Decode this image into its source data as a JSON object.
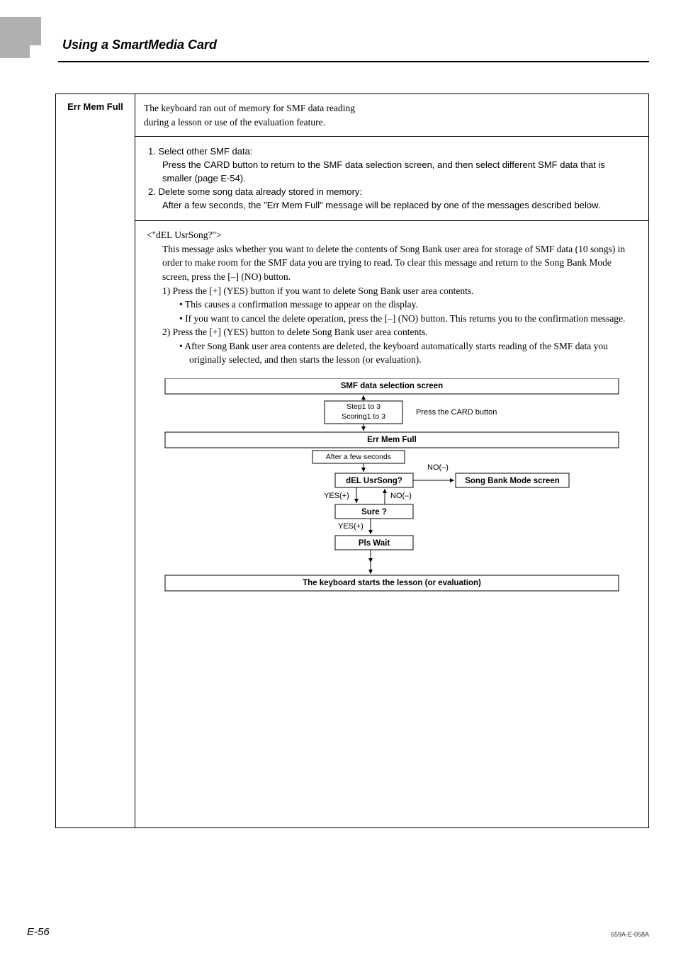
{
  "header": {
    "title": "Using a SmartMedia Card"
  },
  "error": {
    "name": "Err  Mem  Full",
    "desc_line1": "The keyboard ran out of memory for SMF data reading",
    "desc_line2": "during a lesson or use of the evaluation feature."
  },
  "solution": {
    "item1_lead": "1.  Select other SMF data:",
    "item1_body": "Press the CARD button to return to the SMF data selection screen, and then select different SMF data that is smaller (page E-54).",
    "item2_lead": "2.  Delete some song data already stored in memory:",
    "item2_body": "After a few seconds, the \"Err Mem Full\" message will be replaced by one of the messages described below."
  },
  "del": {
    "lead": "<\"dEL UsrSong?\">",
    "para": "This message asks whether you want to delete the contents of Song Bank user area for storage of SMF data (10 songs) in order to make room for the SMF data you are trying to read. To clear this message and return to the Song Bank Mode screen, press the [–] (NO) button.",
    "step1": "1)  Press the [+] (YES) button if you want to delete Song Bank user area contents.",
    "bullet1a": "•  This causes a confirmation message to appear on the display.",
    "bullet1b": "•  If you want to cancel the delete operation, press the [–] (NO) button. This returns you to the confirmation message.",
    "step2": "2)  Press the [+] (YES) button to delete Song Bank user area contents.",
    "bullet2a": "•  After Song Bank user area contents are deleted, the keyboard automatically starts reading of the SMF data you originally selected, and then starts the lesson (or evaluation)."
  },
  "flow": {
    "top": "SMF data selection screen",
    "steps_a": "Step1 to 3",
    "steps_b": "Scoring1 to 3",
    "press_card": "Press the CARD button",
    "err": "Err Mem Full",
    "after": "After a few seconds",
    "del_q": "dEL UsrSong?",
    "no": "NO(–)",
    "songbank": "Song Bank Mode screen",
    "yes": "YES(+)",
    "nominus": "NO(–)",
    "sure": "Sure ?",
    "pls": "Pls Wait",
    "bottom": "The keyboard starts the lesson (or evaluation)"
  },
  "footer": {
    "page": "E-56",
    "docid": "659A-E-058A"
  }
}
